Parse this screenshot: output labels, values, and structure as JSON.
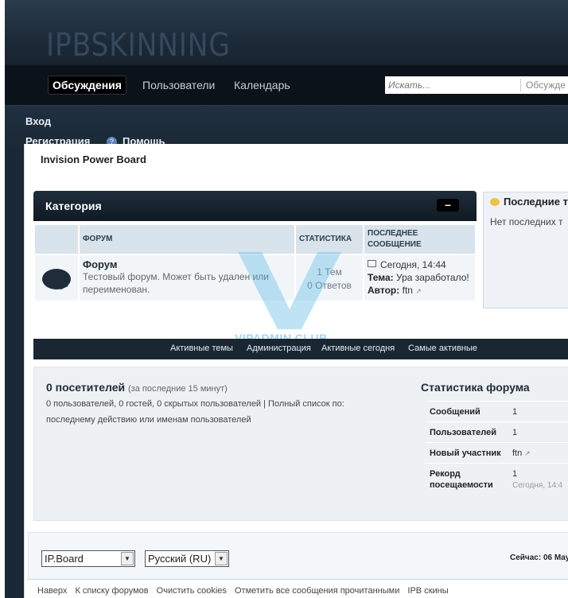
{
  "header": {
    "logo_text": "IPBSKINNING"
  },
  "nav": {
    "tabs": [
      "Обсуждения",
      "Пользователи",
      "Календарь"
    ],
    "search_placeholder": "Искать...",
    "search_scope": "Обсужде"
  },
  "user_links": {
    "login": "Вход",
    "register": "Регистрация",
    "help": "Помощь"
  },
  "board": {
    "title": "Invision Power Board"
  },
  "category": {
    "title": "Категория",
    "toggle_label": "–",
    "columns": {
      "forum": "ФОРУМ",
      "stats": "СТАТИСТИКА",
      "last_post": "ПОСЛЕДНЕЕ СООБЩЕНИЕ"
    },
    "forum": {
      "name": "Форум",
      "description": "Тестовый форум. Может быть удален или переименован.",
      "topics": "1 Тем",
      "replies": "0 Ответов",
      "last_date": "Сегодня, 14:44",
      "topic_label": "Тема:",
      "topic_value": "Ура заработало!",
      "author_label": "Автор:",
      "author_value": "ftn"
    }
  },
  "sidebar": {
    "title": "Последние т",
    "body": "Нет последних т"
  },
  "watermark": {
    "text": "VIPADMIN.CLUB"
  },
  "quick_links": [
    "Активные темы",
    "Администрация",
    "Активные сегодня",
    "Самые активные"
  ],
  "online": {
    "title": "0 посетителей",
    "note": "(за последние 15 минут)",
    "detail_1": "0 пользователей, 0 гостей, 0 скрытых пользователей | Полный список по:",
    "detail_2": "последнему действию или именам пользователей"
  },
  "forum_stats": {
    "title": "Статистика форума",
    "rows": [
      {
        "label": "Сообщений",
        "value": "1"
      },
      {
        "label": "Пользователей",
        "value": "1"
      },
      {
        "label": "Новый участник",
        "value": "ftn"
      },
      {
        "label": "Рекорд посещаемости",
        "value": "1",
        "sub": "Сегодня, 14:4"
      }
    ]
  },
  "footer": {
    "skin_select": "IP.Board",
    "lang_select": "Русский (RU)",
    "time": "Сейчас: 06 May",
    "links": [
      "Наверх",
      "К списку форумов",
      "Очистить cookies",
      "Отметить все сообщения прочитанными",
      "IPB скины"
    ]
  }
}
